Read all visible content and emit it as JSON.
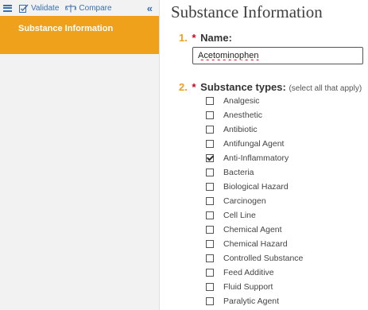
{
  "toolbar": {
    "validate_label": "Validate",
    "compare_label": "Compare",
    "collapse_glyph": "«",
    "icons": [
      "menu-icon",
      "validate-icon",
      "compare-icon",
      "collapse-icon"
    ]
  },
  "sidebar": {
    "active_item": "Substance Information",
    "accent_color": "#f0a11c"
  },
  "page": {
    "title": "Substance Information"
  },
  "question1": {
    "number": "1.",
    "required_mark": "*",
    "label": "Name:",
    "value": "Acetominophen"
  },
  "question2": {
    "number": "2.",
    "required_mark": "*",
    "label": "Substance types:",
    "hint": "(select all that apply)",
    "options": [
      {
        "label": "Analgesic",
        "checked": false
      },
      {
        "label": "Anesthetic",
        "checked": false
      },
      {
        "label": "Antibiotic",
        "checked": false
      },
      {
        "label": "Antifungal Agent",
        "checked": false
      },
      {
        "label": "Anti-Inflammatory",
        "checked": true
      },
      {
        "label": "Bacteria",
        "checked": false
      },
      {
        "label": "Biological Hazard",
        "checked": false
      },
      {
        "label": "Carcinogen",
        "checked": false
      },
      {
        "label": "Cell Line",
        "checked": false
      },
      {
        "label": "Chemical Agent",
        "checked": false
      },
      {
        "label": "Chemical Hazard",
        "checked": false
      },
      {
        "label": "Controlled Substance",
        "checked": false
      },
      {
        "label": "Feed Additive",
        "checked": false
      },
      {
        "label": "Fluid Support",
        "checked": false
      },
      {
        "label": "Paralytic Agent",
        "checked": false
      }
    ]
  }
}
